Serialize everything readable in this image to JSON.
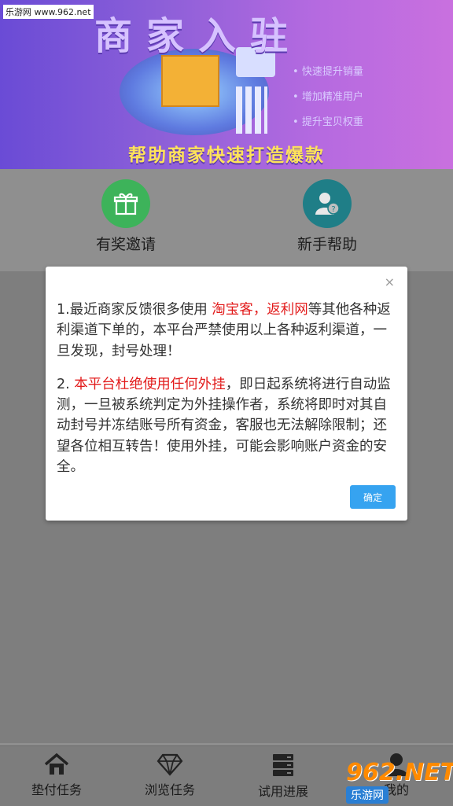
{
  "watermark": "乐游网 www.962.net",
  "banner": {
    "title": "商家入驻",
    "bullets": [
      "快速提升销量",
      "增加精准用户",
      "提升宝贝权重"
    ],
    "subtitle": "帮助商家快速打造爆款"
  },
  "quick_actions": [
    {
      "label": "有奖邀请",
      "icon": "gift-icon",
      "color": "#3db35a"
    },
    {
      "label": "新手帮助",
      "icon": "user-help-icon",
      "color": "#1f7e87"
    }
  ],
  "modal": {
    "close": "×",
    "p1_pre": "1.最近商家反馈很多使用 ",
    "p1_red": "淘宝客，返利网",
    "p1_post": "等其他各种返利渠道下单的，本平台严禁使用以上各种返利渠道，一旦发现，封号处理！",
    "p2_pre": "2. ",
    "p2_red": "本平台杜绝使用任何外挂",
    "p2_post": "，即日起系统将进行自动监测，一旦被系统判定为外挂操作者，系统将即时对其自动封号并冻结账号所有资金，客服也无法解除限制；还望各位相互转告！使用外挂，可能会影响账户资金的安全。",
    "ok": "确定"
  },
  "tabs": [
    {
      "label": "垫付任务",
      "icon": "home-icon"
    },
    {
      "label": "浏览任务",
      "icon": "diamond-icon"
    },
    {
      "label": "试用进展",
      "icon": "server-icon"
    },
    {
      "label": "我的",
      "icon": "user-icon"
    }
  ],
  "logo": {
    "main": "962.NET",
    "sub": "乐游网"
  }
}
